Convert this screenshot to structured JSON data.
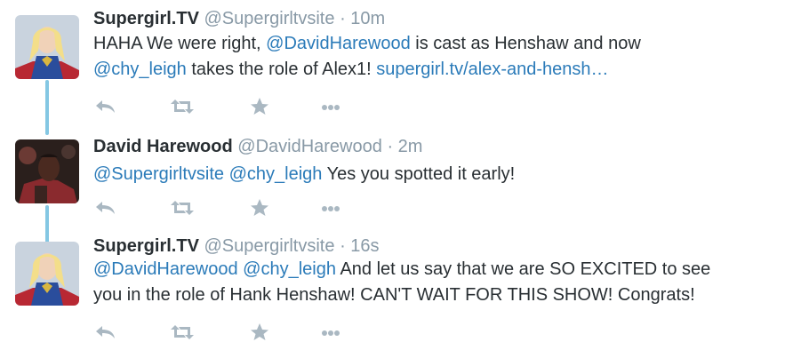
{
  "tweets": [
    {
      "fullname": "Supergirl.TV",
      "username": "@Supergirltvsite",
      "separator": "·",
      "time": "10m",
      "line1_prefix": "HAHA We were right, ",
      "line1_mention": "@DavidHarewood",
      "line1_suffix": " is cast as Henshaw and now",
      "line2_mention": "@chy_leigh",
      "line2_middle": " takes the role of Alex1! ",
      "line2_link": "supergirl.tv/alex-and-hensh…",
      "avatar_icon": "supergirl-avatar"
    },
    {
      "fullname": "David Harewood",
      "username": "@DavidHarewood",
      "separator": "·",
      "time": "2m",
      "mention1": "@Supergirltvsite",
      "mention2": "@chy_leigh",
      "body": " Yes you spotted it early!",
      "avatar_icon": "david-harewood-avatar"
    },
    {
      "fullname": "Supergirl.TV",
      "username": "@Supergirltvsite",
      "separator": "·",
      "time": "16s",
      "mention1": "@DavidHarewood",
      "mention2": "@chy_leigh",
      "line1_body": " And let us say that we are SO EXCITED to see",
      "line2": "you in the role of Hank Henshaw! CAN'T WAIT FOR THIS SHOW! Congrats!",
      "avatar_icon": "supergirl-avatar"
    }
  ],
  "actions": [
    {
      "name": "reply",
      "icon": "reply-icon"
    },
    {
      "name": "retweet",
      "icon": "retweet-icon"
    },
    {
      "name": "favorite",
      "icon": "star-icon"
    },
    {
      "name": "more",
      "icon": "more-icon"
    }
  ],
  "colors": {
    "text": "#292f33",
    "muted": "#8899a6",
    "link": "#2b7bb9",
    "action_icon": "#aab8c2",
    "thread_line": "#84c7e3"
  }
}
